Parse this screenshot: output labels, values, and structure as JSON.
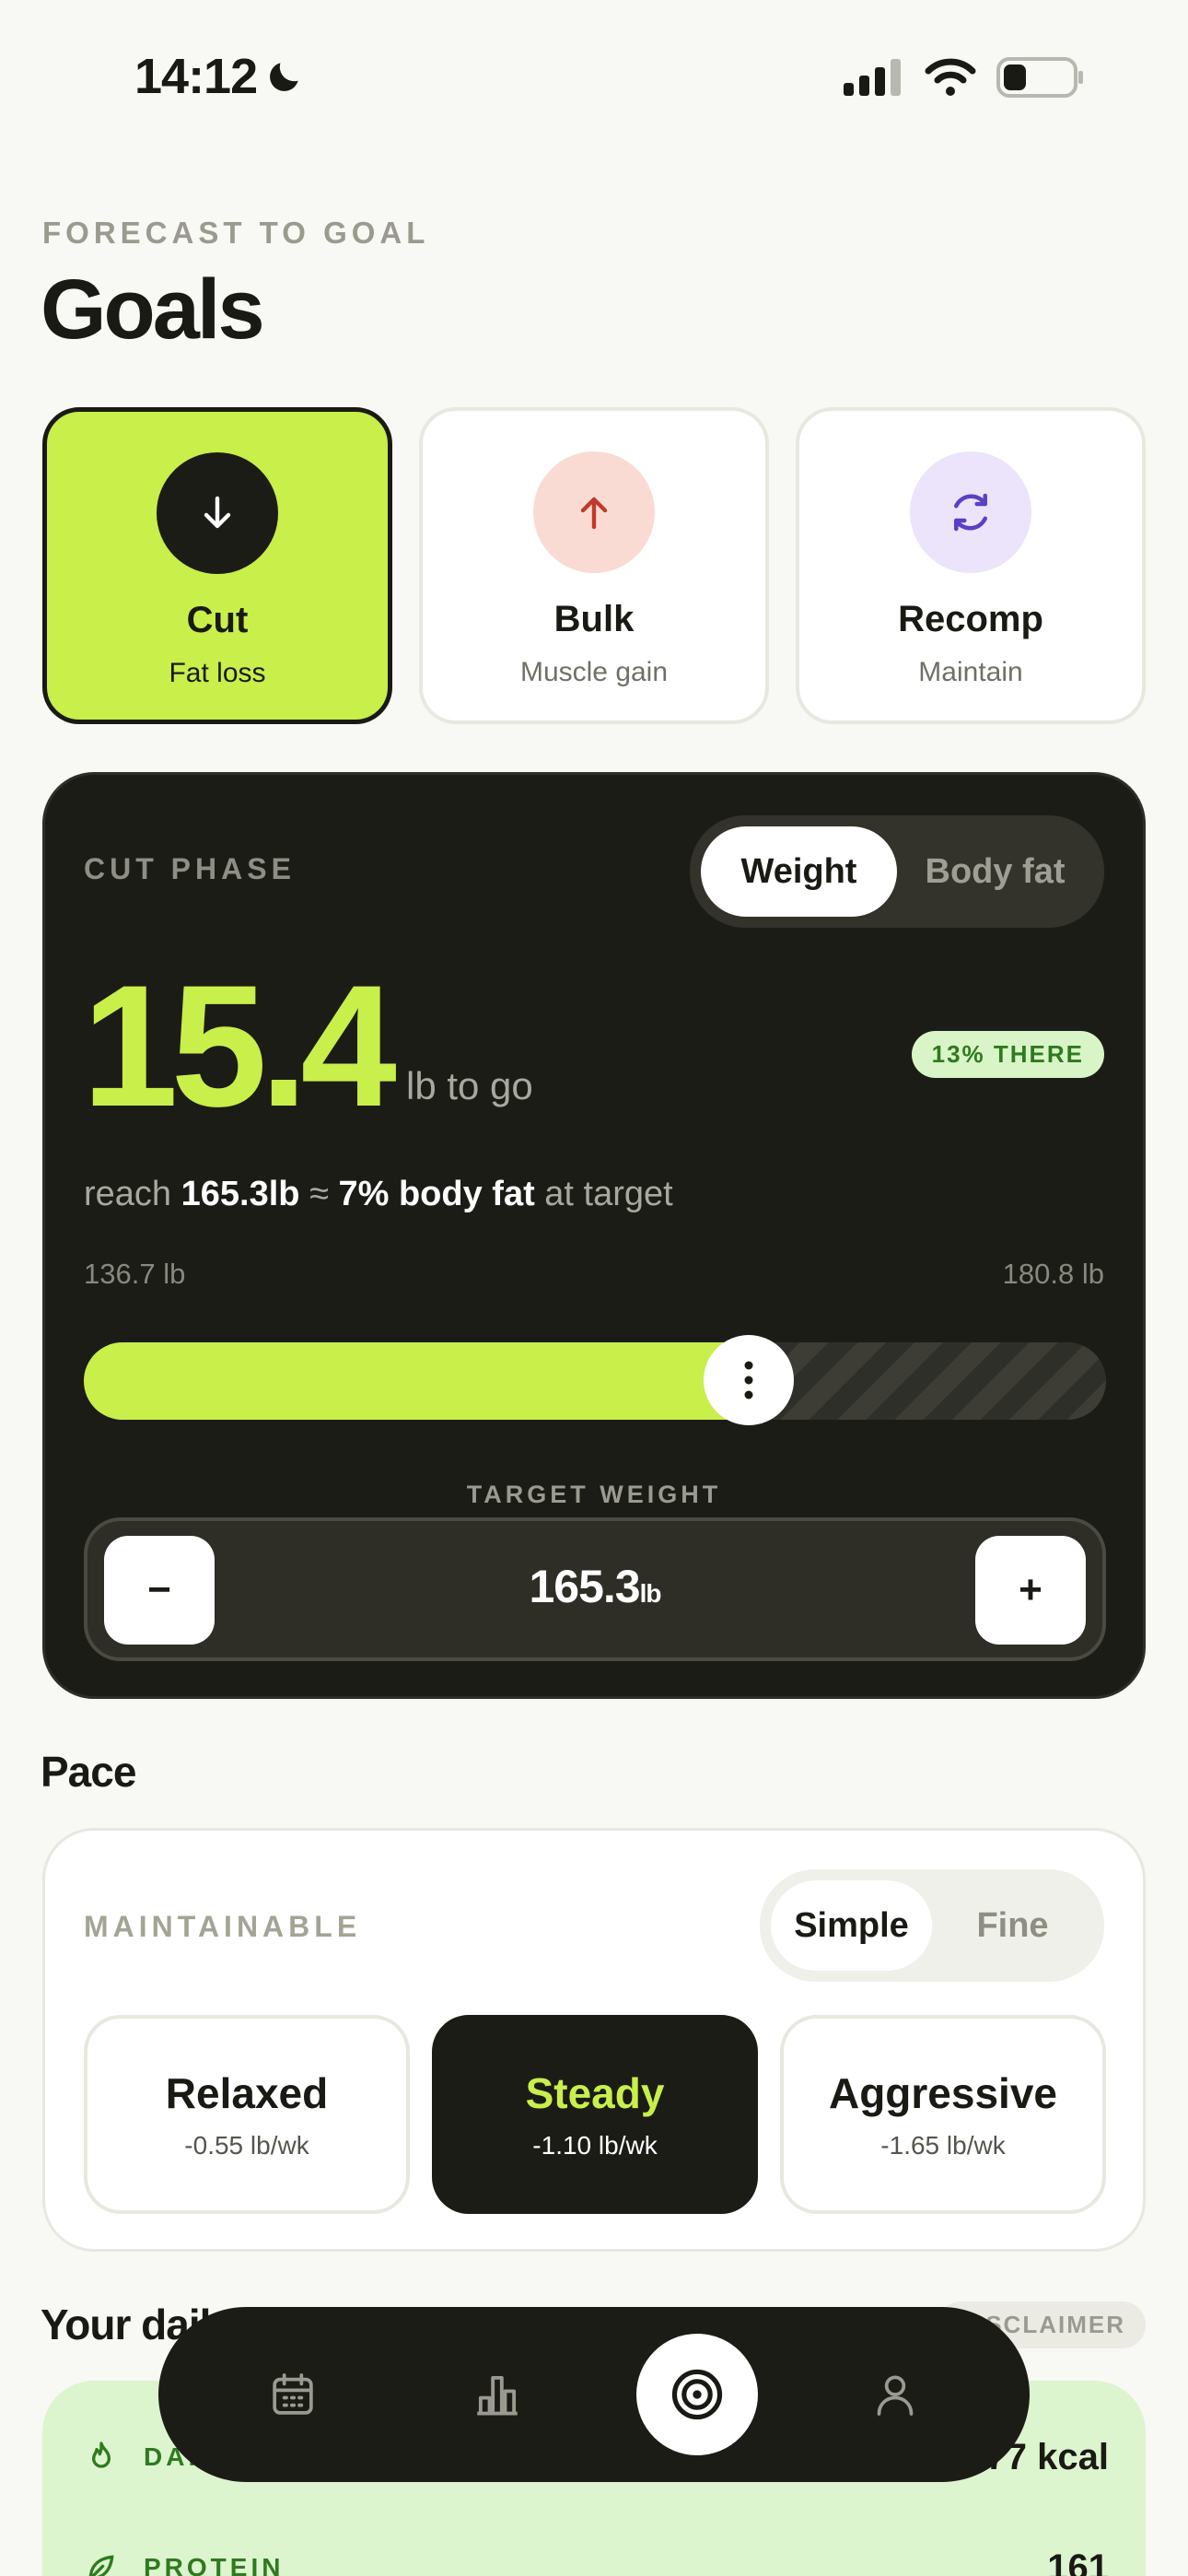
{
  "status_bar": {
    "time": "14:12"
  },
  "header": {
    "eyebrow": "FORECAST TO GOAL",
    "title": "Goals"
  },
  "goals": [
    {
      "name": "Cut",
      "sub": "Fat loss",
      "icon": "arrow-down-icon",
      "selected": true
    },
    {
      "name": "Bulk",
      "sub": "Muscle gain",
      "icon": "arrow-up-icon",
      "selected": false
    },
    {
      "name": "Recomp",
      "sub": "Maintain",
      "icon": "refresh-icon",
      "selected": false
    }
  ],
  "phase": {
    "label": "CUT PHASE",
    "tabs": [
      "Weight",
      "Body fat"
    ],
    "active_tab": "Weight",
    "remaining": "15.4",
    "remaining_unit": "lb to go",
    "progress_badge": "13% THERE",
    "reach_prefix": "reach",
    "reach_weight": "165.3lb",
    "reach_approx": "≈",
    "reach_bodyfat": "7% body fat",
    "reach_suffix": "at target",
    "range_min": "136.7 lb",
    "range_max": "180.8 lb",
    "slider_fraction": 0.65,
    "target_label": "TARGET WEIGHT",
    "minus_label": "−",
    "plus_label": "+",
    "target_value": "165.3",
    "target_unit": "lb"
  },
  "pace": {
    "title": "Pace",
    "label": "MAINTAINABLE",
    "modes": [
      "Simple",
      "Fine"
    ],
    "active_mode": "Simple",
    "options": [
      {
        "name": "Relaxed",
        "rate": "-0.55 lb/wk",
        "active": false
      },
      {
        "name": "Steady",
        "rate": "-1.10 lb/wk",
        "active": true
      },
      {
        "name": "Aggressive",
        "rate": "-1.65 lb/wk",
        "active": false
      }
    ]
  },
  "daily": {
    "title": "Your daily",
    "disclaimer": "DISCLAIMER",
    "rows": [
      {
        "label": "DAILY",
        "value": "2,077 kcal",
        "icon": "flame-icon"
      },
      {
        "label": "PROTEIN",
        "value": "161",
        "icon": "leaf-icon"
      }
    ]
  },
  "tabbar": {
    "items": [
      "calendar-icon",
      "chart-icon",
      "target-icon",
      "profile-icon"
    ],
    "active": "target-icon"
  },
  "colors": {
    "accent": "#c8ef4a",
    "dark": "#1c1c17",
    "background": "#f8f8f4",
    "success": "#2f7a1f"
  }
}
